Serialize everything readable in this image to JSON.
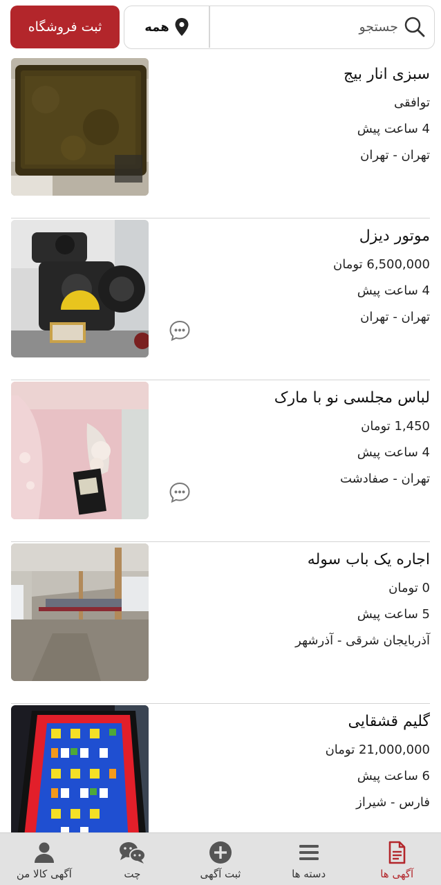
{
  "header": {
    "shop_button": "ثبت فروشگاه",
    "search_placeholder": "جستجو",
    "location_filter": "همه"
  },
  "listings": [
    {
      "title": "سبزی انار بیج",
      "price": "توافقی",
      "time": "4 ساعت پیش",
      "location": "تهران - تهران",
      "has_chat": false,
      "image": "dried-herbs-tray"
    },
    {
      "title": "موتور دیزل",
      "price": "6,500,000 تومان",
      "time": "4 ساعت پیش",
      "location": "تهران - تهران",
      "has_chat": true,
      "image": "diesel-engine"
    },
    {
      "title": "لباس مجلسی نو با مارک",
      "price": "1,450 تومان",
      "time": "4 ساعت پیش",
      "location": "تهران - صفادشت",
      "has_chat": true,
      "image": "pink-dress"
    },
    {
      "title": "اجاره یک باب سوله",
      "price": "0 تومان",
      "time": "5 ساعت پیش",
      "location": "آذربایجان شرقی - آذرشهر",
      "has_chat": false,
      "image": "warehouse-interior"
    },
    {
      "title": "گلیم قشقایی",
      "price": "21,000,000 تومان",
      "time": "6 ساعت پیش",
      "location": "فارس - شیراز",
      "has_chat": false,
      "image": "kilim-rug"
    }
  ],
  "bottom_nav": [
    {
      "label": "آگهی ها",
      "icon": "document-icon",
      "active": true
    },
    {
      "label": "دسته ها",
      "icon": "menu-icon",
      "active": false
    },
    {
      "label": "ثبت آگهی",
      "icon": "plus-circle-icon",
      "active": false
    },
    {
      "label": "چت",
      "icon": "chat-bubbles-icon",
      "active": false
    },
    {
      "label": "آگهی کالا من",
      "icon": "user-icon",
      "active": false
    }
  ],
  "colors": {
    "brand": "#b3262b",
    "nav_bg": "#e2e2e2",
    "divider": "#d4d4d4"
  }
}
